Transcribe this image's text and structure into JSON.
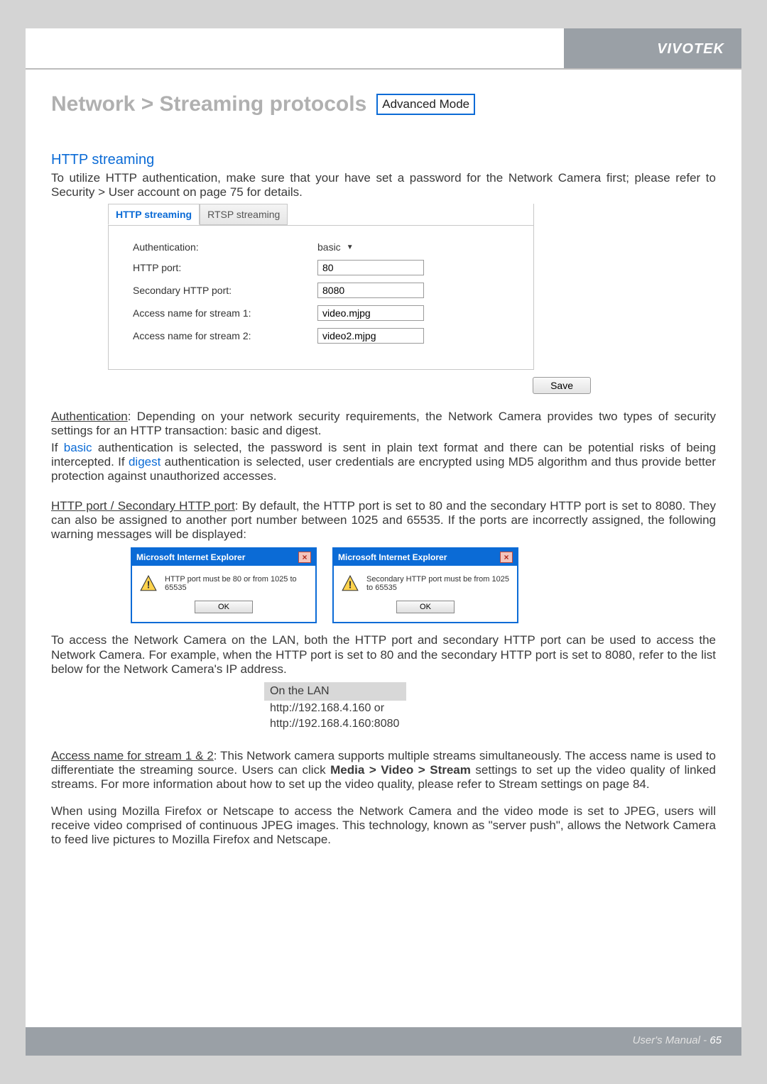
{
  "brand": "VIVOTEK",
  "title": "Network > Streaming protocols",
  "adv_badge": "Advanced Mode",
  "section_heading": "HTTP streaming",
  "intro": "To utilize HTTP authentication, make sure that your have set a password for the Network Camera first; please refer to Security > User account on page 75 for details.",
  "tabs": {
    "http": "HTTP streaming",
    "rtsp": "RTSP streaming"
  },
  "form": {
    "auth_label": "Authentication:",
    "auth_value": "basic",
    "http_port_label": "HTTP port:",
    "http_port_value": "80",
    "sec_port_label": "Secondary HTTP port:",
    "sec_port_value": "8080",
    "stream1_label": "Access name for stream 1:",
    "stream1_value": "video.mjpg",
    "stream2_label": "Access name for stream 2:",
    "stream2_value": "video2.mjpg",
    "save": "Save"
  },
  "auth_para_prefix_u": "Authentication",
  "auth_para_rest": ": Depending on your network security requirements, the Network Camera provides two types of security settings for an HTTP transaction: basic and digest.",
  "auth_para2_a": "If ",
  "auth_para2_basic": "basic",
  "auth_para2_b": " authentication is selected, the password is sent in plain text format and there can be potential risks of being intercepted. If ",
  "auth_para2_digest": "digest",
  "auth_para2_c": " authentication is selected, user credentials are encrypted using MD5 algorithm and thus provide better protection against unauthorized accesses.",
  "port_para_u": "HTTP port / Secondary HTTP port",
  "port_para_rest": ": By default, the HTTP port is set to 80 and the secondary HTTP port is set to 8080. They can also be assigned to another port number between 1025 and 65535. If the ports are incorrectly assigned, the following warning messages will be displayed:",
  "dialog": {
    "title": "Microsoft Internet Explorer",
    "msg1": "HTTP port must be 80 or from 1025 to 65535",
    "msg2": "Secondary HTTP port must be from 1025 to 65535",
    "ok": "OK"
  },
  "lan_para": "To access the Network Camera on the LAN, both the HTTP port and secondary HTTP port can be used to access the Network Camera. For example, when the HTTP port is set to 80 and the secondary HTTP port is set to 8080, refer to the list below for the Network Camera's IP address.",
  "lan_box": {
    "head": "On the LAN",
    "line1": "http://192.168.4.160  or",
    "line2": "http://192.168.4.160:8080"
  },
  "access_u": "Access name for stream 1 & 2",
  "access_a": ": This Network camera supports multiple streams simultaneously. The access name is used to differentiate the streaming source. Users can click ",
  "access_bold": "Media > Video > Stream",
  "access_b": " settings to set up the video quality of linked streams. For more information about how to set up the video quality, please refer to Stream settings on page 84.",
  "mozilla_para": "When using Mozilla Firefox or  Netscape  to access the Network Camera and the video mode is set to JPEG, users will receive video comprised of continuous JPEG images. This technology, known as \"server push\", allows the Network Camera to feed live pictures to Mozilla Firefox and Netscape.",
  "footer": {
    "label": "User's Manual - ",
    "page": "65"
  }
}
